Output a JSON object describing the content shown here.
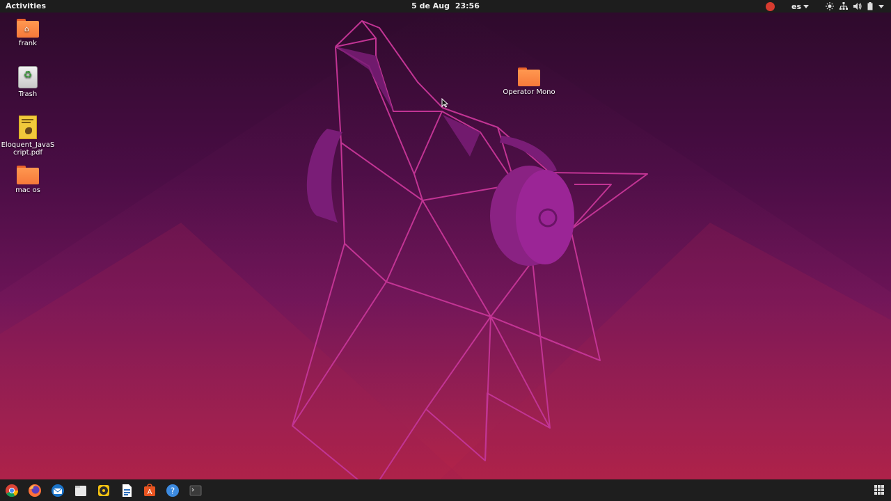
{
  "topbar": {
    "activities": "Activities",
    "date": "5 de Aug",
    "time": "23:56",
    "language": "es",
    "tray_icons": [
      "recording-indicator",
      "brightness-icon",
      "network-icon",
      "volume-icon",
      "battery-icon",
      "system-menu-caret"
    ]
  },
  "desktop": {
    "icons": [
      {
        "label": "frank",
        "type": "home-folder"
      },
      {
        "label": "Trash",
        "type": "trash"
      },
      {
        "label": "Eloquent_JavaScript.pdf",
        "line1": "Eloquent_JavaS",
        "line2": "cript.pdf",
        "type": "pdf"
      },
      {
        "label": "mac os",
        "type": "folder"
      },
      {
        "label": "Operator Mono",
        "type": "folder"
      }
    ]
  },
  "dock": {
    "apps": [
      "chrome-icon",
      "firefox-icon",
      "thunderbird-icon",
      "files-icon",
      "rhythmbox-icon",
      "writer-icon",
      "software-center-icon",
      "help-icon",
      "terminal-icon"
    ],
    "show_apps": "show-applications-icon"
  },
  "colors": {
    "panel": "#1d1d1d",
    "folder": "#f6793a",
    "wallpaper_top": "#3b0b2e",
    "wallpaper_bottom": "#b8203c",
    "line_art": "#d0369a"
  }
}
